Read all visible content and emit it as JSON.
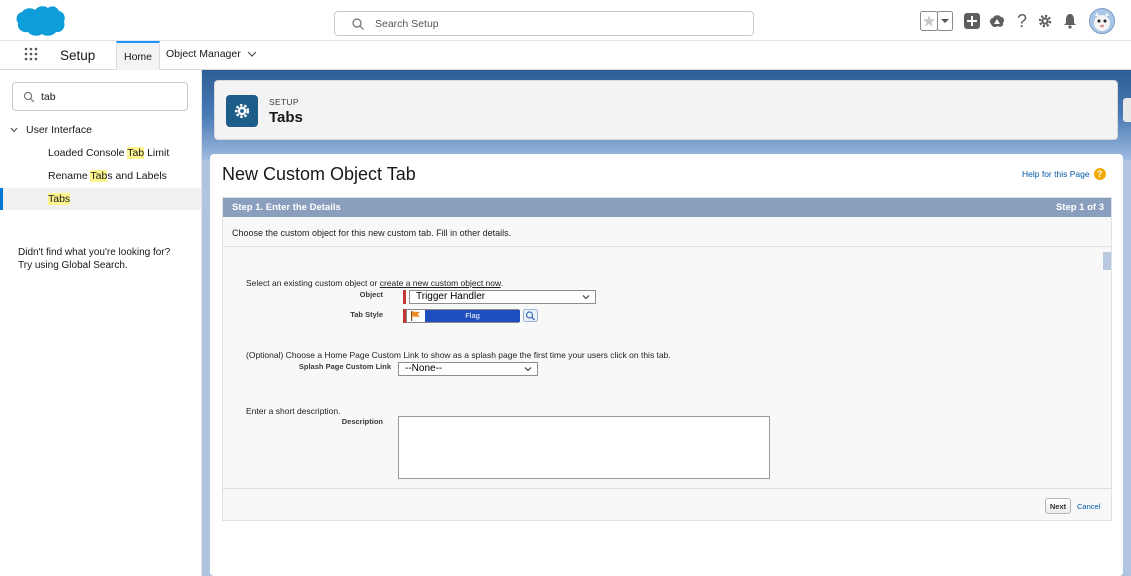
{
  "header": {
    "search_placeholder": "Search Setup",
    "icons": [
      "favorites-star-icon",
      "favorites-dropdown-icon",
      "global-actions-icon",
      "trailhead-icon",
      "help-icon",
      "setup-gear-icon",
      "notifications-bell-icon",
      "user-avatar"
    ]
  },
  "nav": {
    "app_name": "Setup",
    "tabs": [
      {
        "label": "Home",
        "active": true
      },
      {
        "label": "Object Manager",
        "active": false
      }
    ]
  },
  "sidebar": {
    "quick_find_value": "tab",
    "group": "User Interface",
    "items": [
      {
        "before": "Loaded Console ",
        "match": "Tab",
        "after": " Limit",
        "active": false
      },
      {
        "before": "Rename ",
        "match": "Tab",
        "after": "s and Labels",
        "active": false
      },
      {
        "before": "",
        "match": "Tabs",
        "after": "",
        "active": true
      }
    ],
    "not_found_line1": "Didn't find what you're looking for?",
    "not_found_line2": "Try using Global Search."
  },
  "setup_header": {
    "kicker": "SETUP",
    "title": "Tabs"
  },
  "page": {
    "title": "New Custom Object Tab",
    "help_link": "Help for this Page",
    "step_title": "Step 1. Enter the Details",
    "step_counter": "Step 1 of 3",
    "intro": "Choose the custom object for this new custom tab. Fill in other details.",
    "object_section_prefix": "Select an existing custom object or ",
    "object_section_link": "create a new custom object now",
    "object_section_suffix": ".",
    "object_label": "Object",
    "object_value": "Trigger Handler",
    "tab_style_label": "Tab Style",
    "tab_style_value": "Flag",
    "splash_section": "(Optional) Choose a Home Page Custom Link to show as a splash page the first time your users click on this tab.",
    "splash_label": "Splash Page Custom Link",
    "splash_value": "--None--",
    "description_section": "Enter a short description.",
    "description_label": "Description",
    "description_value": "",
    "next_label": "Next",
    "cancel_label": "Cancel"
  },
  "colors": {
    "brand_blue": "#0176d3",
    "step_bar": "#8a9ebe",
    "required": "#c23934",
    "flag_selection": "#1f4fbf",
    "help_badge": "#f2a900"
  }
}
